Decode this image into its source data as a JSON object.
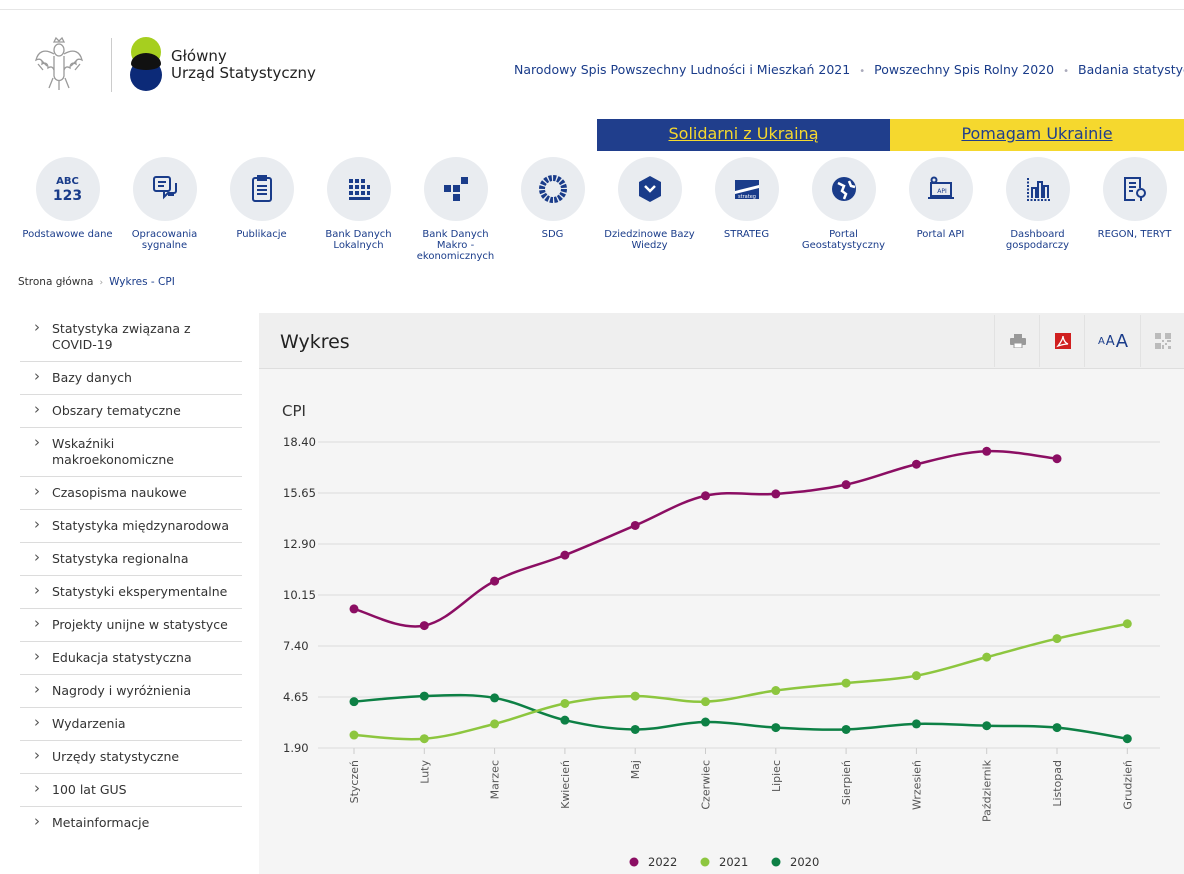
{
  "logo": {
    "line1": "Główny",
    "line2": "Urząd Statystyczny"
  },
  "topnav": [
    "Narodowy Spis Powszechny Ludności i Mieszkań 2021",
    "Powszechny Spis Rolny 2020",
    "Badania statystyczne"
  ],
  "ukraine": {
    "left": "Solidarni z Ukrainą",
    "right": "Pomagam Ukrainie",
    "blue": "#203e8c",
    "yellow": "#f5d82e"
  },
  "quick_links": [
    {
      "label": "Podstawowe dane",
      "icon": "abc-123-icon",
      "icon_text": "ABC 123"
    },
    {
      "label": "Opracowania sygnalne",
      "icon": "chat-document-icon"
    },
    {
      "label": "Publikacje",
      "icon": "clipboard-list-icon"
    },
    {
      "label": "Bank Danych Lokalnych",
      "icon": "building-grid-icon"
    },
    {
      "label": "Bank Danych Makro - ekonomicznych",
      "icon": "blocks-icon"
    },
    {
      "label": "SDG",
      "icon": "sdg-wheel-icon"
    },
    {
      "label": "Dziedzinowe Bazy Wiedzy",
      "icon": "hexagon-icon"
    },
    {
      "label": "STRATEG",
      "icon": "strateg-logo-icon",
      "icon_text": "strateg"
    },
    {
      "label": "Portal Geostatystyczny",
      "icon": "globe-icon"
    },
    {
      "label": "Portal API",
      "icon": "api-icon",
      "icon_text": "API"
    },
    {
      "label": "Dashboard gospodarczy",
      "icon": "bar-chart-icon"
    },
    {
      "label": "REGON, TERYT",
      "icon": "document-search-icon"
    }
  ],
  "breadcrumb": {
    "home": "Strona główna",
    "current": "Wykres - CPI"
  },
  "sidebar": [
    "Statystyka związana z COVID-19",
    "Bazy danych",
    "Obszary tematyczne",
    "Wskaźniki makroekonomiczne",
    "Czasopisma naukowe",
    "Statystyka międzynarodowa",
    "Statystyka regionalna",
    "Statystyki eksperymentalne",
    "Projekty unijne w statystyce",
    "Edukacja statystyczna",
    "Nagrody i wyróżnienia",
    "Wydarzenia",
    "Urzędy statystyczne",
    "100 lat GUS",
    "Metainformacje"
  ],
  "panel": {
    "title": "Wykres",
    "font_sizes": [
      "A",
      "A",
      "A"
    ]
  },
  "chart_data": {
    "type": "line",
    "title": "CPI",
    "xlabel": "",
    "ylabel": "",
    "categories": [
      "Styczeń",
      "Luty",
      "Marzec",
      "Kwiecień",
      "Maj",
      "Czerwiec",
      "Lipiec",
      "Sierpień",
      "Wrzesień",
      "Październik",
      "Listopad",
      "Grudzień"
    ],
    "yticks": [
      "1.90",
      "4.65",
      "7.40",
      "10.15",
      "12.90",
      "15.65",
      "18.40"
    ],
    "ylim": [
      1.9,
      18.4
    ],
    "grid": true,
    "legend": "bottom",
    "series": [
      {
        "name": "2022",
        "color": "#8b0e63",
        "values": [
          9.4,
          8.5,
          10.9,
          12.3,
          13.9,
          15.5,
          15.6,
          16.1,
          17.2,
          17.9,
          17.5,
          null
        ]
      },
      {
        "name": "2021",
        "color": "#8dc63f",
        "values": [
          2.6,
          2.4,
          3.2,
          4.3,
          4.7,
          4.4,
          5.0,
          5.4,
          5.8,
          6.8,
          7.8,
          8.6
        ]
      },
      {
        "name": "2020",
        "color": "#0d8045",
        "values": [
          4.4,
          4.7,
          4.6,
          3.4,
          2.9,
          3.3,
          3.0,
          2.9,
          3.2,
          3.1,
          3.0,
          2.4
        ]
      }
    ]
  }
}
